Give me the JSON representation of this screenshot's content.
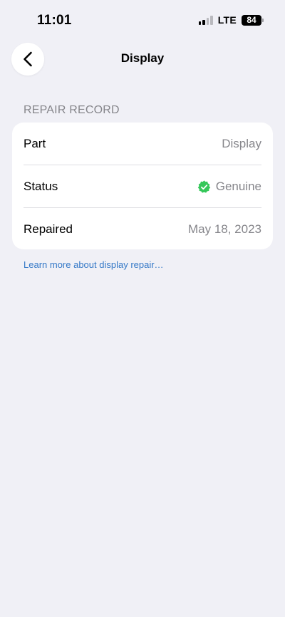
{
  "status_bar": {
    "time": "11:01",
    "network": "LTE",
    "battery": "84"
  },
  "nav": {
    "title": "Display",
    "back_icon": "chevron-left-icon"
  },
  "repair_record": {
    "header": "REPAIR RECORD",
    "rows": [
      {
        "label": "Part",
        "value": "Display"
      },
      {
        "label": "Status",
        "value": "Genuine",
        "icon": "verified-badge-icon",
        "icon_color": "#34c759"
      },
      {
        "label": "Repaired",
        "value": "May 18, 2023"
      }
    ]
  },
  "learn_more": {
    "text": "Learn more about display repair…",
    "color": "#3478c7"
  },
  "colors": {
    "background": "#f0f0f6",
    "card": "#ffffff",
    "secondary_text": "#86868b"
  }
}
